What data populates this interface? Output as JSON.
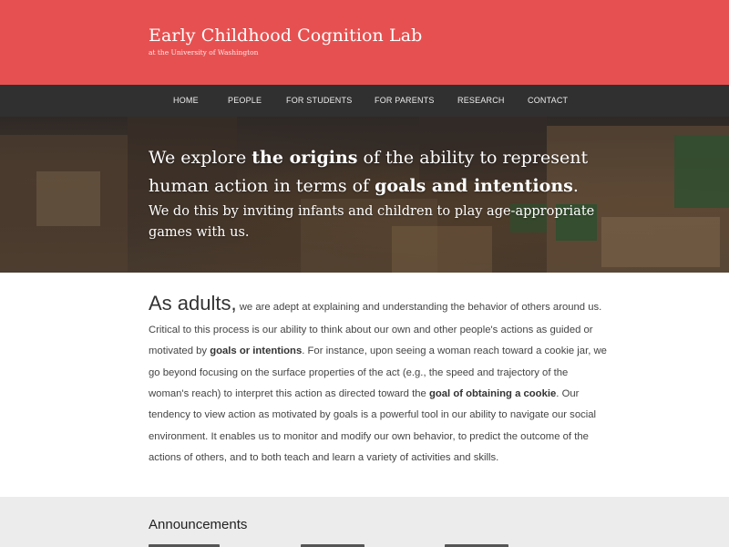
{
  "header": {
    "title": "Early Childhood Cognition Lab",
    "subtitle": "at the University of Washington",
    "background_color": "#e75050"
  },
  "nav": {
    "items": [
      {
        "label": "HOME"
      },
      {
        "label": "PEOPLE"
      },
      {
        "label": "FOR STUDENTS"
      },
      {
        "label": "FOR PARENTS"
      },
      {
        "label": "RESEARCH"
      },
      {
        "label": "CONTACT"
      }
    ],
    "background_color": "#303030"
  },
  "hero": {
    "line1_a": "We explore ",
    "line1_b": "the origins",
    "line1_c": " of the ability to represent",
    "line2_a": "human action in terms of ",
    "line2_b": "goals and intentions",
    "line2_c": ".",
    "line3": "We do this by inviting infants and children to play age-appropriate",
    "line4": "games with us."
  },
  "intro": {
    "lede": "As adults,",
    "l1": " we are adept at explaining and understanding the behavior of others around us.",
    "l2": "Critical to this process is our ability to think about our own and other people's actions as guided or",
    "l3_a": "motivated by ",
    "l3_b": "goals or intentions",
    "l3_c": ". For instance, upon seeing a woman reach toward a cookie jar, we",
    "l4": "go beyond focusing on the surface properties of the act (e.g., the speed and trajectory of the",
    "l5_a": "woman's reach) to interpret this action as directed toward the ",
    "l5_b": "goal of obtaining a cookie",
    "l5_c": ". Our",
    "l6": "tendency to view action as motivated by goals is a powerful tool in our ability to navigate our social",
    "l7": "environment. It enables us to monitor and modify our own behavior, to predict the outcome of the",
    "l8": "actions of others, and to both teach and learn a variety of activities and skills."
  },
  "announcements": {
    "title": "Announcements"
  }
}
